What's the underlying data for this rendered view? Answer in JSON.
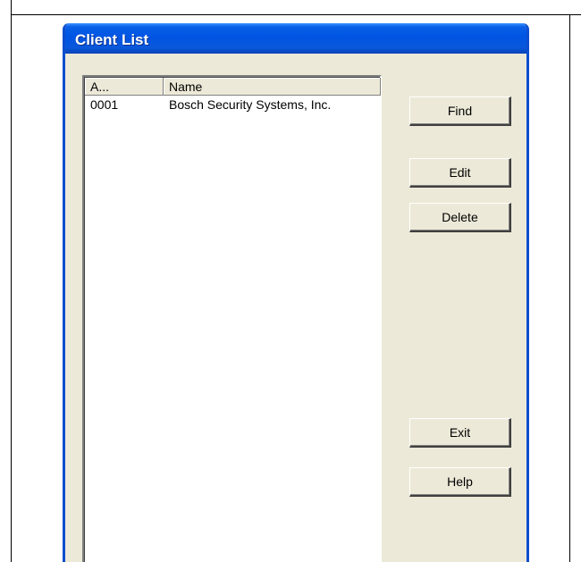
{
  "window": {
    "title": "Client List"
  },
  "list": {
    "columns": [
      "A...",
      "Name"
    ],
    "rows": [
      {
        "account": "0001",
        "name": "Bosch Security Systems, Inc."
      }
    ]
  },
  "buttons": {
    "find": "Find",
    "edit": "Edit",
    "delete": "Delete",
    "exit": "Exit",
    "help": "Help"
  },
  "colors": {
    "titlebar": "#0054e3",
    "dialog_face": "#ece9d8"
  }
}
